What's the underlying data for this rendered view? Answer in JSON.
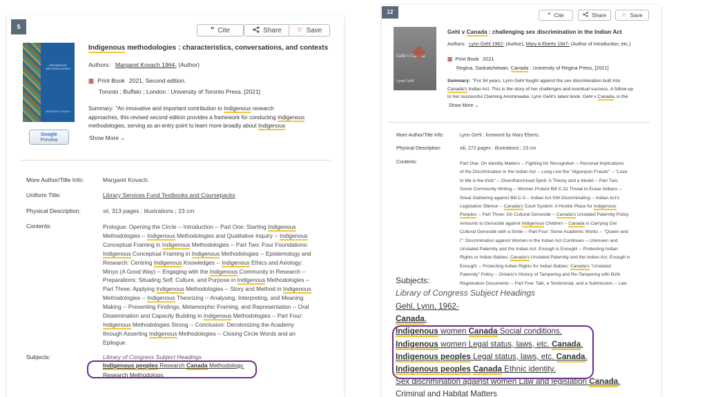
{
  "left": {
    "badge": "5",
    "actions": {
      "cite": "Cite",
      "share": "Share",
      "save": "Save"
    },
    "cover": {
      "title_lines": [
        "INDIGENOUS",
        "METHODOLOGIES"
      ],
      "author": "MARGARET KOVACH",
      "google_preview_line1": "Google",
      "google_preview_line2": "Preview"
    },
    "title_parts": [
      "Indigenous",
      " methodologies : characteristics, conversations, and contexts"
    ],
    "authors_label": "Authors:",
    "author_name": "Margaret Kovach 1964-",
    "author_role": "(Author)",
    "format": "Print Book",
    "edition": "2021, Second edition.",
    "publisher": "Toronto ; Buffalo ; London : University of Toronto Press, [2021]",
    "summary_label": "Summary:",
    "summary_lines": [
      [
        "\"An innovative and important contribution to ",
        "Indigenous",
        " research"
      ],
      [
        "approaches, this revised second edition provides a framework for conducting ",
        "Indigenous",
        ""
      ],
      [
        "methodologies, serving as an entry point to learn more broadly about ",
        "Indigenous",
        ""
      ]
    ],
    "show_more": "Show More",
    "details": {
      "more_author_label": "More Author/Title Info:",
      "more_author_value": "Margaret Kovach.",
      "uniform_title_label": "Uniform Title:",
      "uniform_title_value": "Library Services Fund Textbooks and Coursepacks",
      "physical_label": "Physical Description:",
      "physical_value": "xii, 313 pages : illustrations ; 23 cm",
      "contents_label": "Contents:",
      "contents_lines": [
        [
          "Prologue: Opening the Circle -- Introduction -- Part One: Starting ",
          "Indigenous",
          ""
        ],
        [
          "Methodologies -- ",
          "Indigenous",
          " Methodologies and Qualitative Inquiry -- ",
          "Indigenous",
          ""
        ],
        [
          "Conceptual Framing in ",
          "Indigenous",
          " Methodologies -- Part Two: Four Foundations:"
        ],
        [
          "",
          "Indigenous",
          " Conceptual Framing in ",
          "Indigenous",
          " Methodologies -- Epistemology and"
        ],
        [
          "Research: Centring ",
          "Indigenous",
          " Knowledges -- ",
          "Indigenous",
          " Ethics and Axiology:"
        ],
        [
          "Minyo (A Good Way) -- Engaging with the ",
          "Indigenous",
          " Community in Research --"
        ],
        [
          "Preparations: Situating Self, Culture, and Purpose in ",
          "Indigenous",
          " Methodologies --"
        ],
        [
          "Part Three: Applying ",
          "Indigenous",
          " Methodologies -- Story and Method in ",
          "Indigenous",
          ""
        ],
        [
          "Methodologies -- ",
          "Indigenous",
          " Theorizing -- Analysing, Interpreting, and Meaning"
        ],
        [
          "Making -- Presenting Findings, Metamorphic Framing, and Representation -- Oral"
        ],
        [
          "Dissemination and Capacity Building in ",
          "Indigenous",
          " Methodologies -- Part Four:"
        ],
        [
          "",
          "Indigenous",
          " Methodologies Strong -- Conclusion: Decolonizing the Academy"
        ],
        [
          "through Asserting ",
          "Indigenous",
          " Methodologies -- Closing Circle Words and an"
        ],
        [
          "Epilogue."
        ]
      ],
      "subjects_label": "Subjects:",
      "subjects_heading": "Library of Congress Subject Headings",
      "subject1_parts": [
        "Indigenous peoples",
        " Research ",
        "Canada",
        " Methodology."
      ],
      "subject2": "Research Methodology."
    }
  },
  "right": {
    "badge": "12",
    "actions": {
      "cite": "Cite",
      "share": "Share",
      "save": "Save"
    },
    "cover": {
      "title": "Gehl v Canada",
      "author": "Lynn Gehl"
    },
    "title_parts": [
      "Gehl v ",
      "Canada",
      " : challenging sex discrimination in the Indian Act"
    ],
    "authors_label": "Authors:",
    "author1": "Lynn Gehl 1962-",
    "author1_role": "(Author),",
    "author2": "Mary A Eberts 1947-",
    "author2_role": "(Author of introduction, etc.)",
    "format": "Print Book",
    "year": "2021",
    "publisher_parts": [
      "Regina, Saskatchewan, ",
      "Canada",
      " : University of Regina Press, [2021]"
    ],
    "summary_label": "Summary:",
    "summary_lines": [
      [
        "\"For 34 years, Lynn Gehl fought against the sex discrimination built into"
      ],
      [
        "",
        "Canada's",
        " Indian Act. This is the story of her challenges and eventual success. A follow-up"
      ],
      [
        "to her successful Claiming Anishinaabe, Lynn Gehl's latest book, Gehl v ",
        "Canada",
        ", is the"
      ]
    ],
    "show_more": "Show More",
    "details": {
      "more_author_label": "More Author/Title Info:",
      "more_author_value": "Lynn Gehl ; foreword by Mary Eberts.",
      "physical_label": "Physical Description:",
      "physical_value": "xiii, 272 pages : illustrations ; 23 cm",
      "contents_label": "Contents:",
      "contents_lines": [
        [
          "Part One: On Identity Matters -- Fighting for Recognition -- Personal Implications"
        ],
        [
          "of the Discrimination in the Indian Act -- Long Live the \"Algonquin Frauds\" -- \"Love"
        ],
        [
          "to Me is the Kids\" -- Disenfranchised Spirit: A Theory and a Model -- Part Two:"
        ],
        [
          "Some Community Writing -- Women Protest Bill C-31 Threat to Erase Indians --"
        ],
        [
          "Great Gathering against Bill C-3 -- Indian Act Still Discriminating -- Indian Act's"
        ],
        [
          "Legislative Silence -- ",
          "Canada's",
          " Court System: A Hostile Place for ",
          "Indigenous",
          ""
        ],
        [
          "",
          "Peoples",
          " -- Part Three: On Cultural Genocide -- ",
          "Canada's",
          " Unstated Paternity Policy"
        ],
        [
          "Amounts to Genocide against ",
          "Indigenous",
          " Children -- ",
          "Canada",
          " is Carrying Out"
        ],
        [
          "Cultural Genocide with a Smile -- Part Four: Some Academic Works -- \"Queen and"
        ],
        [
          "I\": Discrimination against Women in the Indian Act Continues -- Unknown and"
        ],
        [
          "Unstated Paternity and the Indian Act: Enough is Enough! -- Protecting Indian"
        ],
        [
          "Rights or Indian Babies: ",
          "Canada's",
          " Unstated Paternity and the Indian Act: Enough is"
        ],
        [
          "Enough! -- Protecting Indian Rights for Indian Babies: ",
          "Canada's",
          " \"Unstated"
        ],
        [
          "Paternity\" Policy -- Ontario's History of Tampering and Re-Tampering with Birth"
        ],
        [
          "Registration Documents -- Part Five: Talk, a Testimonial, and a Submission -- Law"
        ]
      ],
      "subjects_label": "Subjects:",
      "subjects_heading": "Library of Congress Subject Headings",
      "subject_lines": [
        [
          "Gehl, Lynn, 1962-"
        ],
        [
          "",
          "Canada",
          "."
        ],
        [
          "",
          "Indigenous",
          " women ",
          "Canada",
          " Social conditions."
        ],
        [
          "",
          "Indigenous",
          " women Legal status, laws, etc. ",
          "Canada",
          "."
        ],
        [
          "",
          "Indigenous peoples",
          " Legal status, laws, etc. ",
          "Canada",
          "."
        ],
        [
          "",
          "Indigenous peoples",
          " ",
          "Canada",
          " Ethnic identity."
        ],
        [
          "Sex discrimination against women Law and legislation ",
          "Canada",
          "."
        ],
        [
          "Criminal and Habitat Matters"
        ]
      ]
    }
  }
}
